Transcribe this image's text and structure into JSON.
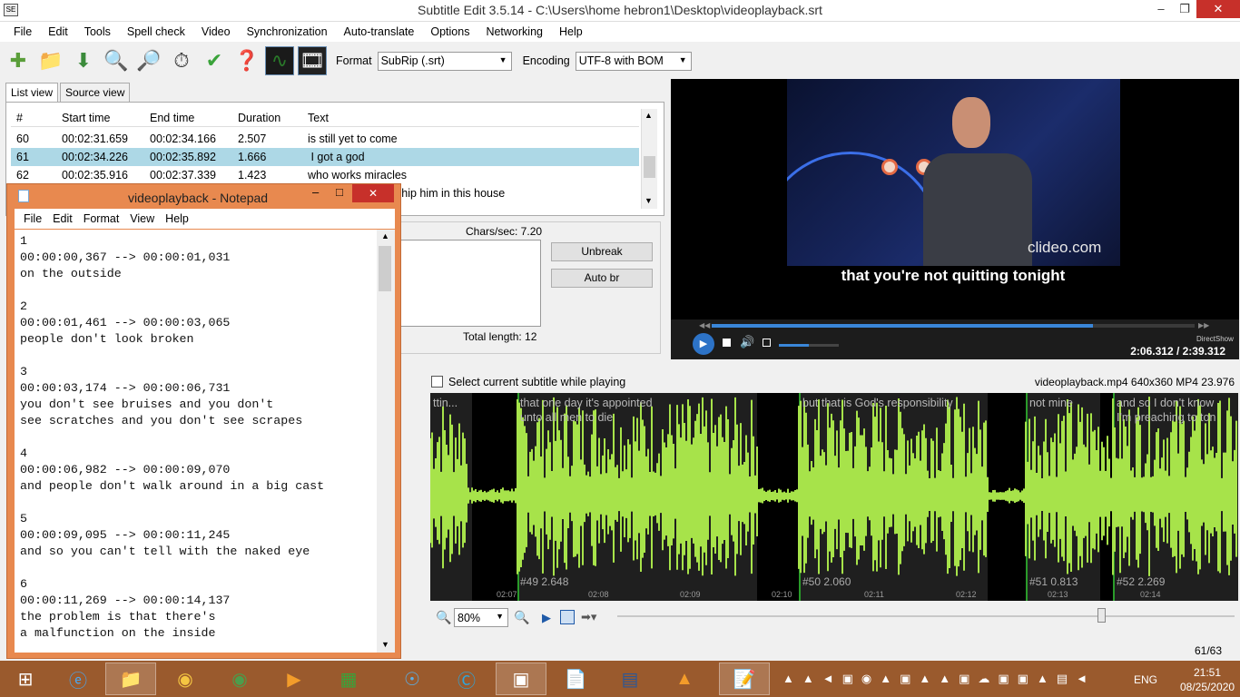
{
  "window": {
    "title": "Subtitle Edit 3.5.14 - C:\\Users\\home hebron1\\Desktop\\videoplayback.srt",
    "icon_text": "SE",
    "minimize": "–",
    "restore": "❐",
    "close": "✕"
  },
  "menu": [
    "File",
    "Edit",
    "Tools",
    "Spell check",
    "Video",
    "Synchronization",
    "Auto-translate",
    "Options",
    "Networking",
    "Help"
  ],
  "toolbar": {
    "format_label": "Format",
    "format_value": "SubRip (.srt)",
    "encoding_label": "Encoding",
    "encoding_value": "UTF-8 with BOM"
  },
  "tabs": [
    "List view",
    "Source view"
  ],
  "list": {
    "headers": [
      "#",
      "Start time",
      "End time",
      "Duration",
      "Text"
    ],
    "rows": [
      {
        "num": "60",
        "start": "00:02:31.659",
        "end": "00:02:34.166",
        "dur": "2.507",
        "text": "is still yet to come"
      },
      {
        "num": "61",
        "start": "00:02:34.226",
        "end": "00:02:35.892",
        "dur": "1.666",
        "text": " I got a god"
      },
      {
        "num": "62",
        "start": "00:02:35.916",
        "end": "00:02:37.339",
        "dur": "1.423",
        "text": "who works miracles"
      },
      {
        "num": "",
        "start": "",
        "end": "",
        "dur": "",
        "text": "ship him in this house"
      }
    ]
  },
  "edit": {
    "chars_sec": "Chars/sec: 7.20",
    "unbreak": "Unbreak",
    "auto_br": "Auto br",
    "total_length": "Total length: 12"
  },
  "video": {
    "watermark": "clideo.com",
    "subtitle": "that you're not quitting tonight",
    "time": "2:06.312 / 2:39.312",
    "renderer": "DirectShow",
    "progress": 0.79,
    "volume": 0.5
  },
  "waveform": {
    "checkbox_label": "Select current subtitle while playing",
    "video_info": "videoplayback.mp4 640x360 MP4 23.976",
    "segments": [
      {
        "text": "ttin...",
        "footer": ""
      },
      {
        "text": "that one day it's appointed\nunto all men to die",
        "footer": "#49  2.648"
      },
      {
        "text": "but that is God's responsibility",
        "footer": "#50  2.060"
      },
      {
        "text": "not mine",
        "footer": "#51  0.813"
      },
      {
        "text": "and so I don't know\nI'm preaching to ton",
        "footer": "#52  2.269"
      }
    ],
    "ticks": [
      "02:07",
      "02:08",
      "02:09",
      "02:10",
      "02:11",
      "02:12",
      "02:13",
      "02:14"
    ],
    "zoom": "80%",
    "counter": "61/63"
  },
  "notepad": {
    "title": "videoplayback - Notepad",
    "menu": [
      "File",
      "Edit",
      "Format",
      "View",
      "Help"
    ],
    "content": "1\n00:00:00,367 --> 00:00:01,031\non the outside\n\n2\n00:00:01,461 --> 00:00:03,065\npeople don't look broken\n\n3\n00:00:03,174 --> 00:00:06,731\nyou don't see bruises and you don't\nsee scratches and you don't see scrapes\n\n4\n00:00:06,982 --> 00:00:09,070\nand people don't walk around in a big cast\n\n5\n00:00:09,095 --> 00:00:11,245\nand so you can't tell with the naked eye\n\n6\n00:00:11,269 --> 00:00:14,137\nthe problem is that there's\na malfunction on the inside"
  },
  "taskbar": {
    "language": "ENG",
    "time": "21:51",
    "date": "08/25/2020"
  }
}
